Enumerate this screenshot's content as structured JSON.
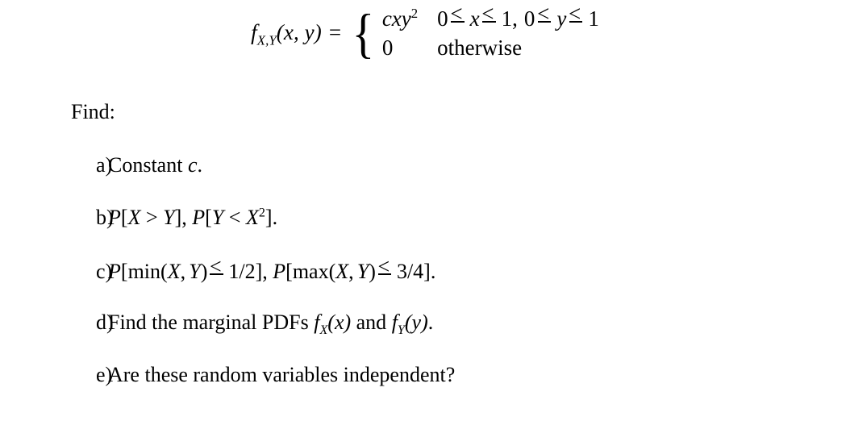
{
  "document": {
    "type": "math-problem",
    "background_color": "#ffffff",
    "text_color": "#000000"
  },
  "formula": {
    "function_name": "f",
    "function_subscript": "X,Y",
    "arguments": "(x, y)",
    "equals": "=",
    "lhs_plain": "f_{X,Y}(x, y) =",
    "cases": [
      {
        "value": "cxy^2",
        "value_plain": "cxy²",
        "condition": "0 ≤ x ≤ 1, 0 ≤ y ≤ 1",
        "condition_plain": "0 ≤ x ≤ 1, 0 ≤ y ≤ 1"
      },
      {
        "value": "0",
        "value_plain": "0",
        "condition": "otherwise",
        "condition_plain": "otherwise"
      }
    ]
  },
  "find_label": "Find:",
  "problems": [
    {
      "marker": "a)",
      "text_plain": "Constant c."
    },
    {
      "marker": "b)",
      "text_plain": "P[X > Y], P[Y < X²]."
    },
    {
      "marker": "c)",
      "text_plain": "P[min(X, Y) ≤ 1/2], P[max(X, Y) ≤ 3/4]."
    },
    {
      "marker": "d)",
      "text_plain": "Find the marginal PDFs f_X(x) and f_Y(y)."
    },
    {
      "marker": "e)",
      "text_plain": "Are these random variables independent?"
    }
  ]
}
